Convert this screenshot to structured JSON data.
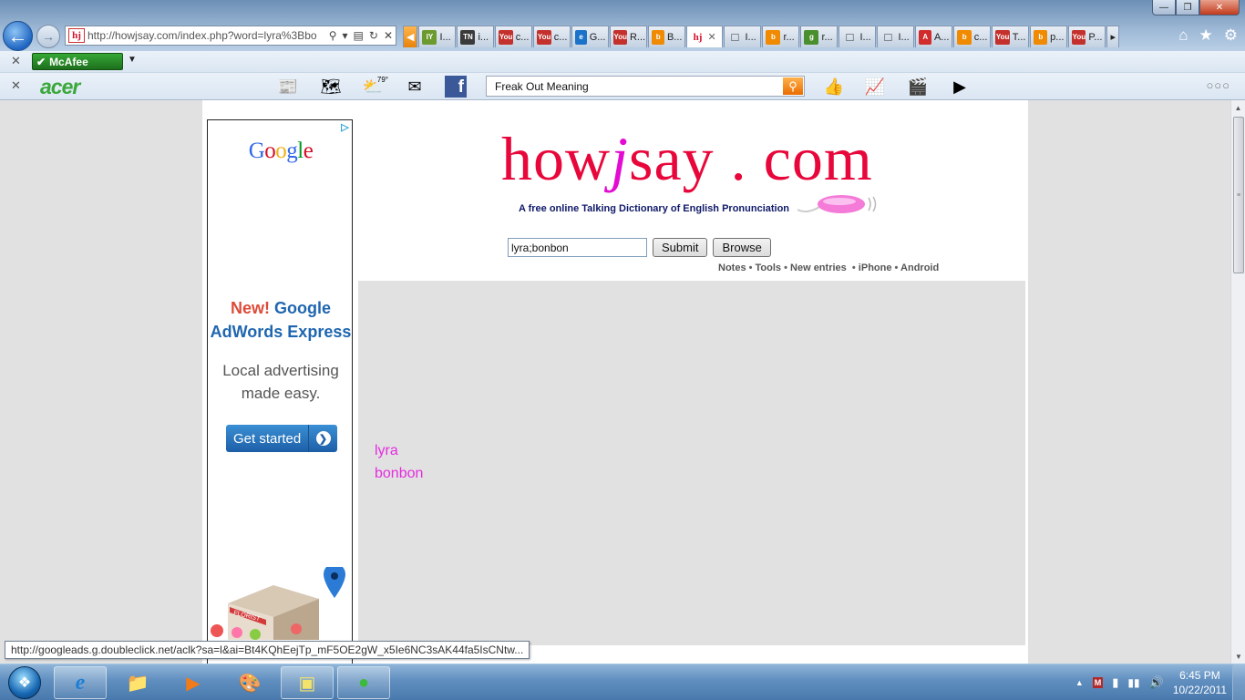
{
  "browser": {
    "url": "http://howjsay.com/index.php?word=lyra%3Bbo",
    "tabs": [
      {
        "icon": "tab-iy-icon",
        "label": "I...",
        "color": "#6c9a2e"
      },
      {
        "icon": "tab-tn-icon",
        "label": "i...",
        "color": "#3a3a3a"
      },
      {
        "icon": "tab-youtube-icon",
        "label": "c...",
        "color": "#c4302b"
      },
      {
        "icon": "tab-youtube-icon",
        "label": "c...",
        "color": "#c4302b"
      },
      {
        "icon": "tab-ie-icon",
        "label": "G...",
        "color": "#1b73c9"
      },
      {
        "icon": "tab-youtube-icon",
        "label": "R...",
        "color": "#c4302b"
      },
      {
        "icon": "tab-bing-icon",
        "label": "B...",
        "color": "#f08a00"
      },
      {
        "icon": "tab-howjsay-icon",
        "label": "",
        "color": "#ffffff",
        "active": true
      },
      {
        "icon": "tab-page-icon",
        "label": "I...",
        "color": "#888888"
      },
      {
        "icon": "tab-bing-icon",
        "label": "r...",
        "color": "#f08a00"
      },
      {
        "icon": "tab-google-icon",
        "label": "r...",
        "color": "#4a8f2e"
      },
      {
        "icon": "tab-page-icon",
        "label": "I...",
        "color": "#888888"
      },
      {
        "icon": "tab-page-icon",
        "label": "I...",
        "color": "#888888"
      },
      {
        "icon": "tab-a-icon",
        "label": "A...",
        "color": "#d12b2b"
      },
      {
        "icon": "tab-bing-icon",
        "label": "c...",
        "color": "#f08a00"
      },
      {
        "icon": "tab-youtube-icon",
        "label": "T...",
        "color": "#c4302b"
      },
      {
        "icon": "tab-bing-icon",
        "label": "p...",
        "color": "#f08a00"
      },
      {
        "icon": "tab-youtube-icon",
        "label": "P...",
        "color": "#c4302b"
      }
    ],
    "tab_favicon_letters": {
      "iy": "IY",
      "tn": "TN",
      "yt": "You",
      "ie": "e",
      "bing": "b",
      "hj": "hj",
      "page": "□",
      "google": "g",
      "a": "A"
    }
  },
  "toolbars": {
    "mcafee_label": "McAfee",
    "acer_label": "acer",
    "weather_temp": "79°",
    "search_value": "Freak Out Meaning"
  },
  "page": {
    "logo_pre": "how",
    "logo_j": "j",
    "logo_post": "say . com",
    "tagline": "A free online Talking Dictionary of English Pronunciation",
    "word_input": "lyra;bonbon",
    "submit_label": "Submit",
    "browse_label": "Browse",
    "links": [
      "Notes",
      "Tools",
      "New entries",
      "iPhone",
      "Android"
    ],
    "results": [
      "lyra",
      "bonbon"
    ]
  },
  "ad": {
    "brand": "Google",
    "new_label": "New!",
    "headline_1": "Google",
    "headline_2": "AdWords Express",
    "tagline_1": "Local advertising",
    "tagline_2": "made easy.",
    "cta_label": "Get started",
    "shop_sign": "FLORIST"
  },
  "status_url": "http://googleads.g.doubleclick.net/aclk?sa=l&ai=Bt4KQhEejTp_mF5OE2gW_x5Ie6NC3sAK44fa5IsCNtw...",
  "taskbar": {
    "time": "6:45 PM",
    "date": "10/22/2011"
  }
}
